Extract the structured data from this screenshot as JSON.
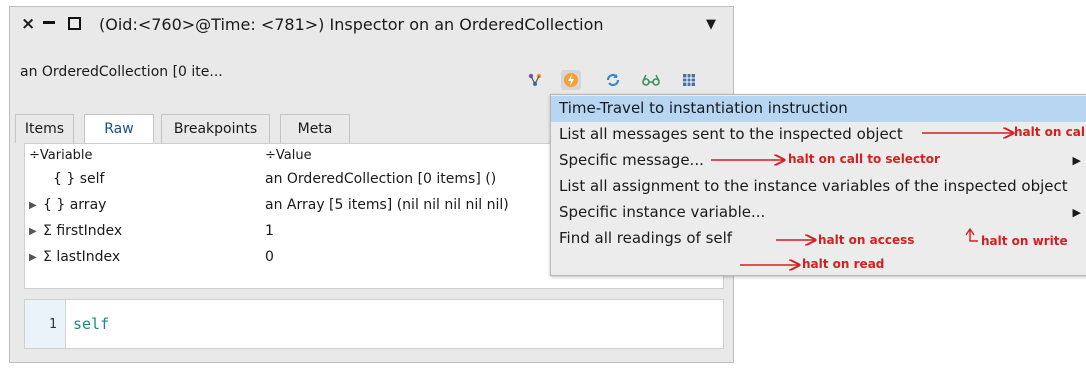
{
  "window": {
    "title": "(Oid:<760>@Time: <781>) Inspector on an OrderedCollection",
    "close_icon": "close-icon",
    "min_icon": "minimize-icon",
    "max_icon": "maximize-icon",
    "menu_icon": "chevron-down-icon"
  },
  "subtitle": "an OrderedCollection [0 ite...",
  "toolbar": [
    {
      "name": "pin-icon",
      "glyph": "♈"
    },
    {
      "name": "halt-icon",
      "glyph": "⚡"
    },
    {
      "name": "refresh-icon",
      "glyph": "↻"
    },
    {
      "name": "glasses-icon",
      "glyph": "👓"
    },
    {
      "name": "grid-icon",
      "glyph": "▦"
    }
  ],
  "tabs": [
    "Items",
    "Raw",
    "Breakpoints",
    "Meta"
  ],
  "table": {
    "col_variable": "Variable",
    "col_value": "Value",
    "sort_icon": "÷",
    "rows": [
      {
        "icon": "{ }",
        "name": "self",
        "value": "an OrderedCollection [0 items] ()",
        "expandable": false
      },
      {
        "icon": "{ }",
        "name": "array",
        "value": "an Array [5 items] (nil nil nil nil nil)",
        "expandable": true
      },
      {
        "icon": "Σ",
        "name": "firstIndex",
        "value": "1",
        "expandable": true
      },
      {
        "icon": "Σ",
        "name": "lastIndex",
        "value": "0",
        "expandable": true
      }
    ]
  },
  "editor": {
    "line": "1",
    "code": "self"
  },
  "menu": {
    "items": [
      "Time-Travel to instantiation instruction",
      "List all messages sent to the inspected object",
      "Specific message...",
      "List all assignment to the instance variables of the inspected object",
      "Specific instance variable...",
      "Find all readings of self"
    ]
  },
  "annotations": {
    "call": "halt on call",
    "selector": "halt on call to selector",
    "access": "halt on access",
    "write": "halt on write",
    "read": "halt on read"
  },
  "colors": {
    "annotation": "#d51f1f",
    "highlight": "#b7d6f2",
    "code": "#1c8a84"
  }
}
